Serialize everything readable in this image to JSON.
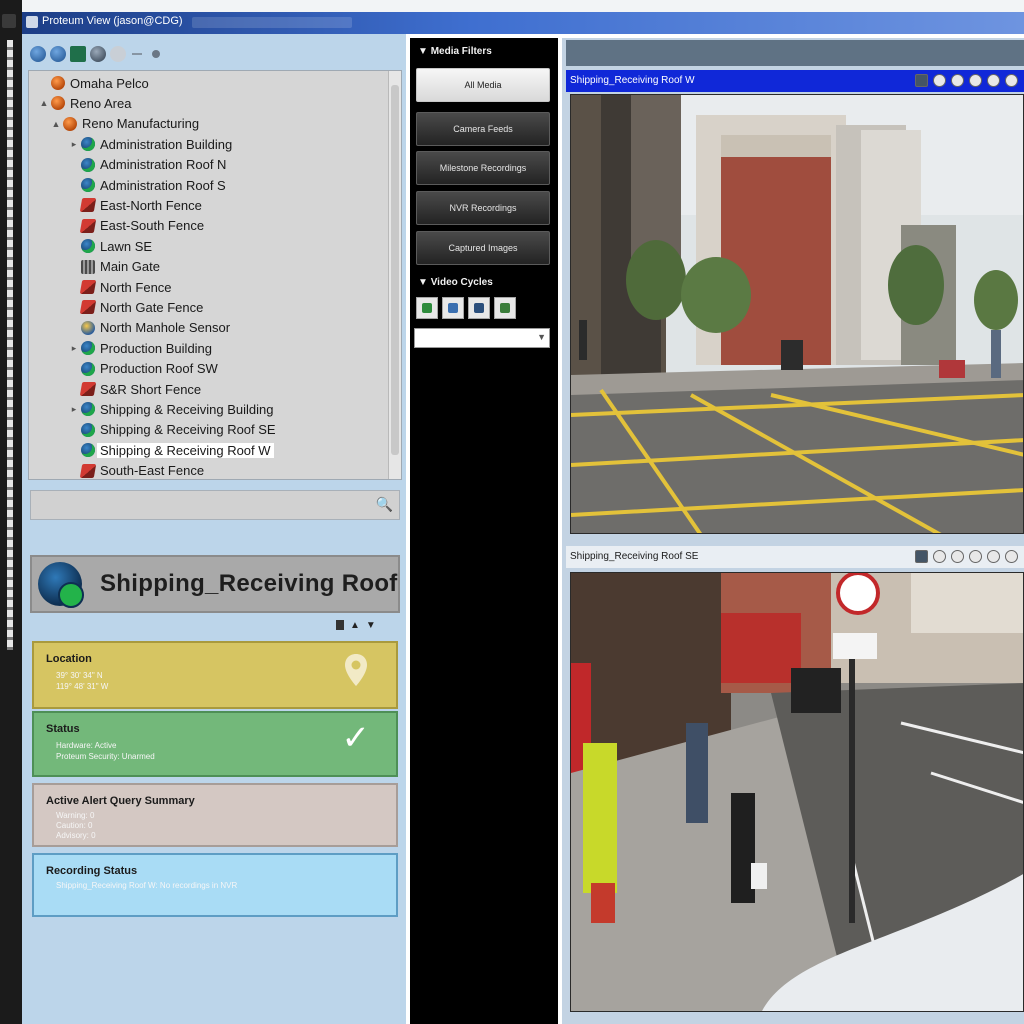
{
  "window": {
    "title": "Proteum View (jason@CDG)"
  },
  "colors": {
    "window_title_bar": "#2b55b8",
    "left_panel_bg": "#bcd5ea",
    "active_camera_header": "#1028d8",
    "location_card": "#d6c562",
    "status_card": "#73b87a",
    "alert_card": "#d4c8c3",
    "recording_card": "#a9dcf5"
  },
  "tree": {
    "items": [
      {
        "label": "Omaha Pelco",
        "icon": "site-icon",
        "expander": "",
        "selected": false
      },
      {
        "label": "Reno Area",
        "icon": "site-icon",
        "expander": "▲",
        "selected": false
      },
      {
        "label": "Reno Manufacturing",
        "icon": "site-icon",
        "expander": "▲",
        "selected": false
      },
      {
        "label": "Administration Building",
        "icon": "camera-icon",
        "expander": "▸",
        "selected": false
      },
      {
        "label": "Administration Roof N",
        "icon": "camera-icon",
        "expander": "",
        "selected": false
      },
      {
        "label": "Administration Roof S",
        "icon": "camera-icon",
        "expander": "",
        "selected": false
      },
      {
        "label": "East-North Fence",
        "icon": "fence-icon",
        "expander": "",
        "selected": false
      },
      {
        "label": "East-South Fence",
        "icon": "fence-icon",
        "expander": "",
        "selected": false
      },
      {
        "label": "Lawn SE",
        "icon": "camera-icon",
        "expander": "",
        "selected": false
      },
      {
        "label": "Main Gate",
        "icon": "gate-icon",
        "expander": "",
        "selected": false
      },
      {
        "label": "North Fence",
        "icon": "fence-icon",
        "expander": "",
        "selected": false
      },
      {
        "label": "North Gate Fence",
        "icon": "fence-icon",
        "expander": "",
        "selected": false
      },
      {
        "label": "North Manhole Sensor",
        "icon": "sensor-icon",
        "expander": "",
        "selected": false
      },
      {
        "label": "Production Building",
        "icon": "camera-icon",
        "expander": "▸",
        "selected": false
      },
      {
        "label": "Production Roof SW",
        "icon": "camera-icon",
        "expander": "",
        "selected": false
      },
      {
        "label": "S&R Short Fence",
        "icon": "fence-icon",
        "expander": "",
        "selected": false
      },
      {
        "label": "Shipping & Receiving Building",
        "icon": "camera-icon",
        "expander": "▸",
        "selected": false
      },
      {
        "label": "Shipping & Receiving Roof SE",
        "icon": "camera-icon",
        "expander": "",
        "selected": false
      },
      {
        "label": "Shipping & Receiving Roof W",
        "icon": "camera-icon",
        "expander": "",
        "selected": true
      },
      {
        "label": "South-East Fence",
        "icon": "fence-icon",
        "expander": "",
        "selected": false
      }
    ]
  },
  "search": {
    "value": "",
    "icon": "search-icon"
  },
  "selected_device": {
    "name": "Shipping_Receiving Roof W",
    "icon": "camera-icon"
  },
  "cards": {
    "location": {
      "title": "Location",
      "lines": [
        "39° 30' 34\" N",
        "119° 48' 31\" W"
      ],
      "icon": "location-pin-icon"
    },
    "status": {
      "title": "Status",
      "lines": [
        "Hardware: Active",
        "Proteum Security: Unarmed"
      ],
      "icon": "checkmark-icon"
    },
    "alert": {
      "title": "Active Alert Query Summary",
      "lines": [
        "Warning: 0",
        "Caution: 0",
        "Advisory: 0"
      ]
    },
    "recording": {
      "title": "Recording Status",
      "lines": [
        "Shipping_Receiving Roof W: No recordings in NVR"
      ]
    }
  },
  "media_filters": {
    "title": "Media Filters",
    "buttons": [
      {
        "label": "All Media",
        "active": true
      },
      {
        "label": "Camera Feeds",
        "active": false
      },
      {
        "label": "Milestone Recordings",
        "active": false
      },
      {
        "label": "NVR Recordings",
        "active": false
      },
      {
        "label": "Captured Images",
        "active": false
      }
    ]
  },
  "video_cycles": {
    "title": "Video Cycles",
    "selected": "",
    "buttons": [
      "cycle-add-icon",
      "cycle-edit-icon",
      "cycle-save-icon",
      "cycle-delete-icon"
    ]
  },
  "video_panes": [
    {
      "title": "Shipping_Receiving Roof W",
      "active": true
    },
    {
      "title": "Shipping_Receiving Roof SE",
      "active": false
    }
  ]
}
